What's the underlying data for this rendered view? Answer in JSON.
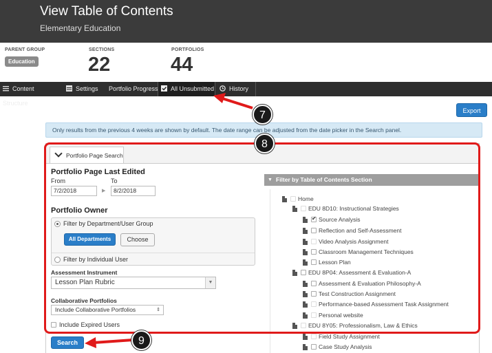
{
  "header": {
    "title": "View Table of Contents",
    "subtitle": "Elementary Education"
  },
  "stats": {
    "parent_group_label": "PARENT GROUP",
    "parent_group_badge": "Education",
    "sections_label": "SECTIONS",
    "sections_value": "22",
    "portfolios_label": "PORTFOLIOS",
    "portfolios_value": "44"
  },
  "tabs": [
    {
      "label": "Content Structure",
      "icon": "list-icon"
    },
    {
      "label": "Settings",
      "icon": "settings-icon"
    },
    {
      "label": "Portfolio Progress",
      "icon": ""
    },
    {
      "label": "All Unsubmitted",
      "icon": "checkbox-icon"
    },
    {
      "label": "History",
      "icon": "history-icon"
    }
  ],
  "export_label": "Export",
  "info_text": "Only results from the previous 4 weeks are shown by default. The date range can be adjusted from the date picker in the Search panel.",
  "search": {
    "tab_label": "Portfolio Page Search",
    "last_edited_heading": "Portfolio Page Last Edited",
    "from_label": "From",
    "to_label": "To",
    "from_value": "7/2/2018",
    "to_value": "8/2/2018",
    "owner_heading": "Portfolio Owner",
    "filter_dept_label": "Filter by Department/User Group",
    "all_departments_label": "All Departments",
    "choose_label": "Choose",
    "filter_user_label": "Filter by Individual User",
    "instrument_label": "Assessment Instrument",
    "instrument_value": "Lesson Plan Rubric",
    "collab_label": "Collaborative Portfolios",
    "collab_value": "Include Collaborative Portfolios",
    "expired_label": "Include Expired Users",
    "search_button": "Search"
  },
  "filter": {
    "heading": "Filter by Table of Contents Section",
    "tree": [
      {
        "label": "Home",
        "checked": false
      },
      {
        "label": "EDU 8D10: Instructional Strategies",
        "checked": false
      },
      {
        "label": "Source Analysis",
        "checked": true
      },
      {
        "label": "Reflection and Self-Assessment",
        "checked": false
      },
      {
        "label": "Video Analysis Assignment",
        "checked": false
      },
      {
        "label": "Classroom Management Techniques",
        "checked": false
      },
      {
        "label": "Lesson Plan",
        "checked": false
      },
      {
        "label": "EDU 8P04: Assessment & Evaluation-A",
        "checked": false
      },
      {
        "label": "Assessment & Evaluation Philosophy-A",
        "checked": false
      },
      {
        "label": "Test Construction Assignment",
        "checked": false
      },
      {
        "label": "Performance-based Assessment Task Assignment",
        "checked": false
      },
      {
        "label": "Personal website",
        "checked": false
      },
      {
        "label": "EDU 8Y05: Professionalism, Law & Ethics",
        "checked": false
      },
      {
        "label": "Field Study Assignment",
        "checked": false
      },
      {
        "label": "Case Study Analysis",
        "checked": false
      }
    ]
  },
  "callouts": {
    "c7": "7",
    "c8": "8",
    "c9": "9"
  },
  "colors": {
    "accent": "#2a7ec8",
    "highlight": "#e01a1a",
    "header_bg": "#3b3b3b"
  }
}
